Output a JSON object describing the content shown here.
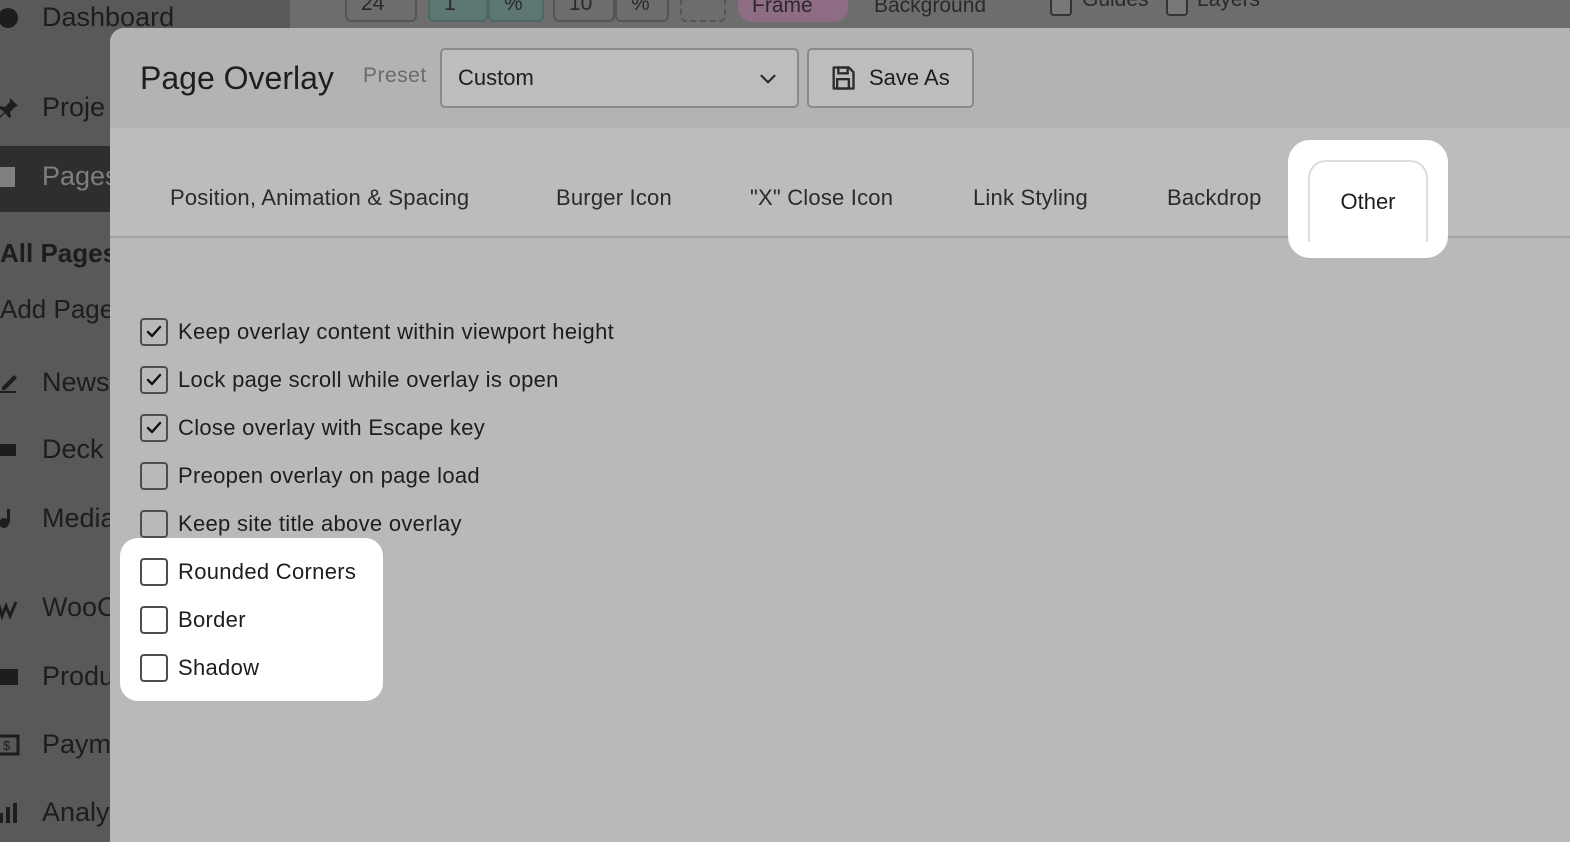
{
  "wp_sidebar": {
    "items": [
      {
        "label": "Dashboard",
        "icon": "dashboard-icon"
      },
      {
        "label": "Proje",
        "icon": "pin-icon"
      },
      {
        "label": "Pages",
        "icon": "pages-icon"
      },
      {
        "label": "News",
        "icon": "edit-icon"
      },
      {
        "label": "Deck",
        "icon": "deck-icon"
      },
      {
        "label": "Media",
        "icon": "media-icon"
      },
      {
        "label": "WooC",
        "icon": "woo-icon"
      },
      {
        "label": "Produ",
        "icon": "products-icon"
      },
      {
        "label": "Paym",
        "icon": "payments-icon"
      },
      {
        "label": "Analy",
        "icon": "analytics-icon"
      }
    ],
    "subitems": [
      "All Pages",
      "Add Page"
    ]
  },
  "toolbar": {
    "values": [
      "24",
      "1",
      "%",
      "10",
      "%"
    ],
    "frame_label": "Frame",
    "background_label": "Background",
    "guides_label": "Guides",
    "layers_label": "Layers"
  },
  "modal": {
    "title": "Page Overlay",
    "preset_label": "Preset",
    "preset_value": "Custom",
    "save_as_label": "Save As",
    "tabs": [
      "Position, Animation & Spacing",
      "Burger Icon",
      "\"X\" Close Icon",
      "Link Styling",
      "Backdrop",
      "Other"
    ],
    "active_tab": "Other",
    "options": [
      {
        "label": "Keep overlay content within viewport height",
        "checked": true
      },
      {
        "label": "Lock page scroll while overlay is open",
        "checked": true
      },
      {
        "label": "Close overlay with Escape key",
        "checked": true
      },
      {
        "label": "Preopen overlay on page load",
        "checked": false
      },
      {
        "label": "Keep site title above overlay",
        "checked": false
      },
      {
        "label": "Rounded Corners",
        "checked": false
      },
      {
        "label": "Border",
        "checked": false
      },
      {
        "label": "Shadow",
        "checked": false
      }
    ]
  }
}
